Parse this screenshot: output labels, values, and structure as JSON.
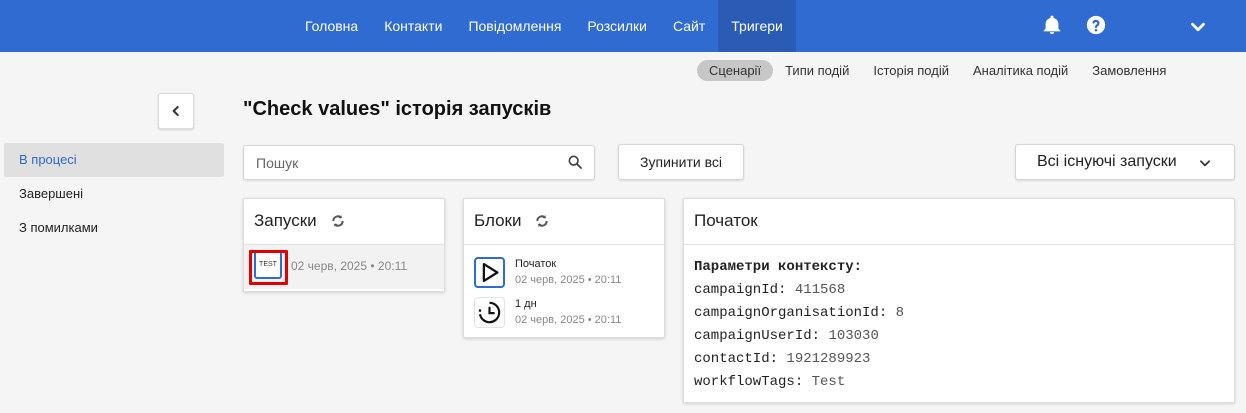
{
  "topnav": {
    "items": [
      {
        "label": "Головна"
      },
      {
        "label": "Контакти"
      },
      {
        "label": "Повідомлення"
      },
      {
        "label": "Розсилки"
      },
      {
        "label": "Сайт"
      },
      {
        "label": "Тригери",
        "active": true
      }
    ],
    "accent_color": "#2f6bd0"
  },
  "subnav": {
    "items": [
      {
        "label": "Сценарії",
        "active": true
      },
      {
        "label": "Типи подій"
      },
      {
        "label": "Історія подій"
      },
      {
        "label": "Аналітика подій"
      },
      {
        "label": "Замовлення"
      }
    ]
  },
  "sidebar": {
    "items": [
      {
        "label": "В процесі",
        "active": true
      },
      {
        "label": "Завершені"
      },
      {
        "label": "З помилками"
      }
    ]
  },
  "page": {
    "title": "\"Check values\" історія запусків"
  },
  "search": {
    "placeholder": "Пошук",
    "value": ""
  },
  "actions": {
    "stop_all_label": "Зупинити всі",
    "runs_filter_label": "Всі існуючі запуски"
  },
  "runs_panel": {
    "title": "Запуски",
    "items": [
      {
        "badge": "TEST",
        "time": "02 черв, 2025 • 20:11"
      }
    ]
  },
  "blocks_panel": {
    "title": "Блоки",
    "items": [
      {
        "name": "Початок",
        "time": "02 черв, 2025 • 20:11",
        "icon": "play-icon"
      },
      {
        "name": "1 дн",
        "time": "02 черв, 2025 • 20:11",
        "icon": "timer-icon"
      }
    ]
  },
  "start_panel": {
    "title": "Початок",
    "context_title": "Параметри контексту:",
    "params": [
      {
        "key": "campaignId:",
        "value": "411568"
      },
      {
        "key": "campaignOrganisationId:",
        "value": "8"
      },
      {
        "key": "campaignUserId:",
        "value": "103030"
      },
      {
        "key": "contactId:",
        "value": "1921289923"
      },
      {
        "key": "workflowTags:",
        "value": "Test"
      }
    ]
  }
}
